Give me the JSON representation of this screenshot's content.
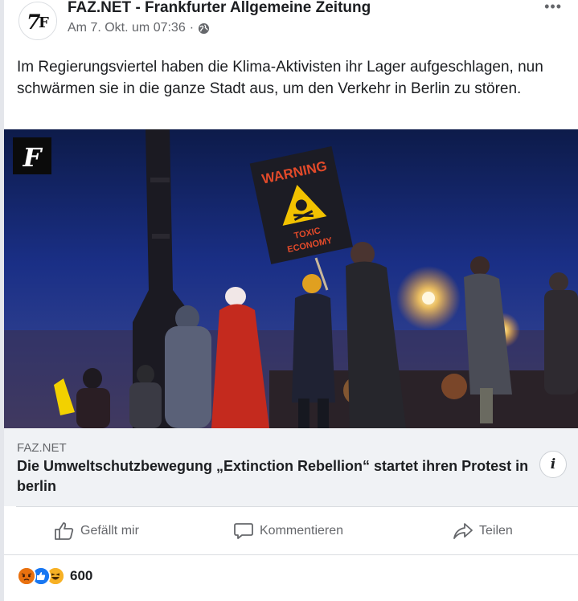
{
  "post": {
    "page_name": "FAZ.NET - Frankfurter Allgemeine Zeitung",
    "timestamp": "Am 7. Okt. um 07:36",
    "separator": "·",
    "audience_icon": "globe-icon",
    "text": "Im Regierungsviertel haben die Klima-Aktivisten ihr Lager aufgeschlagen, nun schwärmen sie in die ganze Stadt aus, um den Verkehr in Berlin zu stören."
  },
  "avatar": {
    "text": "7",
    "monogram": "F"
  },
  "image": {
    "logo_letter": "F",
    "sign_top": "WARNING",
    "sign_line1": "TOXIC",
    "sign_line2": "ECONOMY"
  },
  "link": {
    "domain": "FAZ.NET",
    "title": "Die Umweltschutzbewegung „Extinction Rebellion“ startet ihren Protest in berlin",
    "info_icon": "i"
  },
  "actions": {
    "like": "Gefällt mir",
    "comment": "Kommentieren",
    "share": "Teilen"
  },
  "reactions": {
    "count": "600",
    "icons": [
      "angry-icon",
      "like-icon",
      "haha-icon"
    ]
  },
  "colors": {
    "text": "#1c1e21",
    "secondary": "#65676b",
    "link_bg": "#f0f2f5",
    "like_blue": "#1877f2",
    "angry": "#e9710f",
    "haha": "#f7b125"
  }
}
